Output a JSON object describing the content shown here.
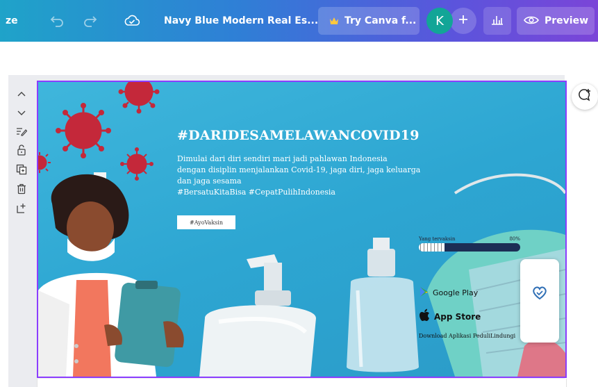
{
  "topbar": {
    "resize_fragment": "ze",
    "doc_title": "Navy Blue Modern Real Es...",
    "try_canva": "Try Canva f...",
    "avatar_initial": "K",
    "preview": "Preview"
  },
  "design": {
    "headline": "#DARIDESAMELAWANCOVID19",
    "body_lines": [
      "Dimulai dari diri sendiri mari jadi pahlawan Indonesia",
      "dengan disiplin menjalankan Covid-19, jaga diri, jaga keluarga",
      "dan jaga sesama",
      "#BersatuKitaBisa #CepatPulihIndonesia"
    ],
    "cta": "#AyoVaksin",
    "progress_label_left": "Yang tervaksin",
    "progress_label_right": "80%",
    "progress_value": 0.8,
    "google_play": "Google Play",
    "app_store": "App Store",
    "download_text": "Download Aplikasi PeduliLindungi"
  },
  "colors": {
    "accent": "#8b3dff",
    "topbar_start": "#1fa3c9",
    "topbar_end": "#7b45d8",
    "design_bg": "#2da6d2",
    "virus": "#c4283a",
    "avatar_bg": "#12a597"
  },
  "icons": {
    "undo": "undo-icon",
    "redo": "redo-icon",
    "cloud_saved": "cloud-check-icon",
    "crown": "crown-icon",
    "plus": "plus-icon",
    "chart": "bar-chart-icon",
    "eye": "eye-icon",
    "comment": "add-comment-icon"
  }
}
